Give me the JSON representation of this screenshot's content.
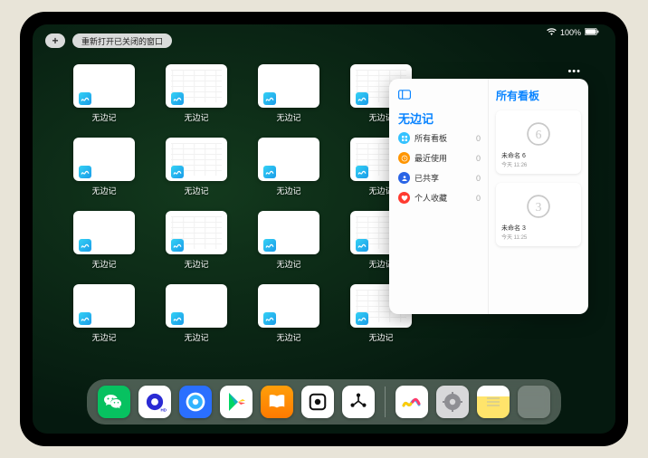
{
  "status": {
    "wifi": "wifi-icon",
    "battery_pct": "100%"
  },
  "topbar": {
    "plus_label": "+",
    "reopen_label": "重新打开已关闭的窗口"
  },
  "app": {
    "name": "无边记",
    "rows": [
      [
        {
          "style": "blank"
        },
        {
          "style": "detail"
        },
        {
          "style": "blank"
        },
        {
          "style": "detail"
        }
      ],
      [
        {
          "style": "blank"
        },
        {
          "style": "detail"
        },
        {
          "style": "blank"
        },
        {
          "style": "detail"
        }
      ],
      [
        {
          "style": "blank"
        },
        {
          "style": "detail"
        },
        {
          "style": "blank"
        },
        {
          "style": "detail"
        }
      ],
      [
        {
          "style": "blank"
        },
        {
          "style": "blank"
        },
        {
          "style": "blank"
        },
        {
          "style": "detail"
        }
      ]
    ]
  },
  "panel": {
    "title_left": "无边记",
    "title_right": "所有看板",
    "sidebar": [
      {
        "icon": "grid-icon",
        "color": "#34c2ff",
        "label": "所有看板",
        "count": "0"
      },
      {
        "icon": "clock-icon",
        "color": "#ff9500",
        "label": "最近使用",
        "count": "0"
      },
      {
        "icon": "people-icon",
        "color": "#2964e6",
        "label": "已共享",
        "count": "0"
      },
      {
        "icon": "heart-icon",
        "color": "#ff3b30",
        "label": "个人收藏",
        "count": "0"
      }
    ],
    "boards": [
      {
        "glyph": "6",
        "name": "未命名 6",
        "sub": "今天 11:26"
      },
      {
        "glyph": "3",
        "name": "未命名 3",
        "sub": "今天 11:25"
      }
    ],
    "ellipsis": "•••"
  },
  "dock": {
    "items": [
      {
        "name": "wechat",
        "label": "WeChat"
      },
      {
        "name": "quark",
        "label": "Quark"
      },
      {
        "name": "qqbrowser",
        "label": "QQ Browser"
      },
      {
        "name": "play",
        "label": "Google Play"
      },
      {
        "name": "books",
        "label": "Books"
      },
      {
        "name": "screens",
        "label": "Stage"
      },
      {
        "name": "hub",
        "label": "Hub"
      }
    ],
    "recent": [
      {
        "name": "freeform",
        "label": "Freeform"
      },
      {
        "name": "settings",
        "label": "Settings"
      },
      {
        "name": "notes",
        "label": "Notes"
      },
      {
        "name": "folder",
        "label": "App Library"
      }
    ]
  }
}
